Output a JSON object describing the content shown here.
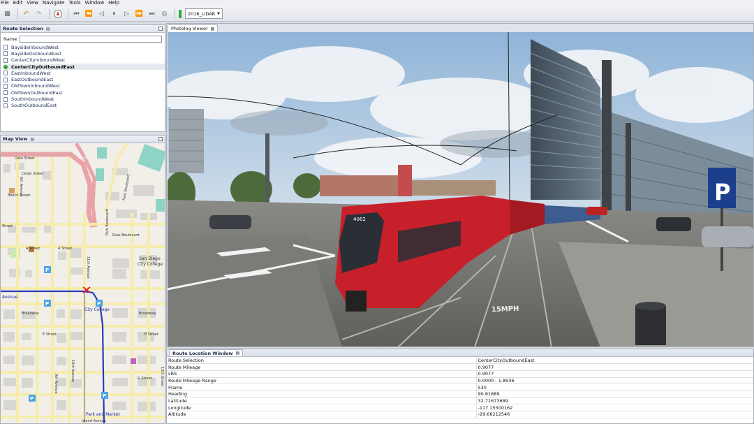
{
  "menu": [
    "File",
    "Edit",
    "View",
    "Navigate",
    "Tools",
    "Window",
    "Help"
  ],
  "toolbar": {
    "dataset": "2016_LIDAR"
  },
  "route_selection": {
    "title": "Route Selection",
    "name_label": "Name:",
    "name_value": "",
    "routes": [
      {
        "label": "BaysideInboundWest",
        "selected": false
      },
      {
        "label": "BaysideOutboundEast",
        "selected": false
      },
      {
        "label": "CenterCityInboundWest",
        "selected": false
      },
      {
        "label": "CenterCityOutboundEast",
        "selected": true
      },
      {
        "label": "EastInboundWest",
        "selected": false
      },
      {
        "label": "EastOutboundEast",
        "selected": false
      },
      {
        "label": "OldTownInboundWest",
        "selected": false
      },
      {
        "label": "OldTownOutboundEast",
        "selected": false
      },
      {
        "label": "SouthInboundWest",
        "selected": false
      },
      {
        "label": "SouthOutboundEast",
        "selected": false
      }
    ]
  },
  "map_view": {
    "title": "Map View",
    "labels": {
      "date_street": "Date Street",
      "cedar_street": "Cedar Street",
      "beech_street": "Beech Street",
      "c_street_1": "Street",
      "a_street_1": "A Street",
      "a_street_2": "A Street",
      "russ_blvd": "Russ Boulevard",
      "sd_city_college_1": "San Diego",
      "sd_city_college_2": "City College",
      "park_blvd_1": "Park Boulevard",
      "park_blvd_2": "Park Boulevard",
      "avenue": "Avenue",
      "city_college": "City College",
      "broadway_1": "Broadway",
      "broadway_2": "Broadway",
      "e_street_1": "E Street",
      "e_street_2": "E Street",
      "g_street": "G Street",
      "park_market": "Park and Market",
      "island_avenue": "Island Avenue",
      "ca163": "CA 163",
      "sixth_ave": "6th Avenue",
      "tenth_ave": "10th Avenue",
      "eleventh_ave": "11th Avenue",
      "thirteenth": "13th Street",
      "ninth_ave": "9th Avenue"
    }
  },
  "photolog": {
    "tab": "Photolog Viewer",
    "tram_number": "4062",
    "road_marking": "15MPH",
    "parking_sign": "P"
  },
  "route_location": {
    "title": "Route Location Window",
    "rows": [
      {
        "key": "Route Selection",
        "value": "CenterCityOutboundEast"
      },
      {
        "key": "Route Mileage",
        "value": "0.9077"
      },
      {
        "key": "LRS",
        "value": "0.9077"
      },
      {
        "key": "Route Mileage Range",
        "value": "0.0000 - 1.8936"
      },
      {
        "key": "Frame",
        "value": "530"
      },
      {
        "key": "Heading",
        "value": "90.81889"
      },
      {
        "key": "Latitude",
        "value": "32.71673689"
      },
      {
        "key": "Longitude",
        "value": "-117.15500162"
      },
      {
        "key": "Altitude",
        "value": "-29.66212546"
      }
    ]
  },
  "colors": {
    "accent_green": "#29a832",
    "tram_red": "#c8202b",
    "route_blue": "#2a3bb8",
    "map_road_yellow": "#f6ecad",
    "highway_pink": "#e8a3a8"
  }
}
